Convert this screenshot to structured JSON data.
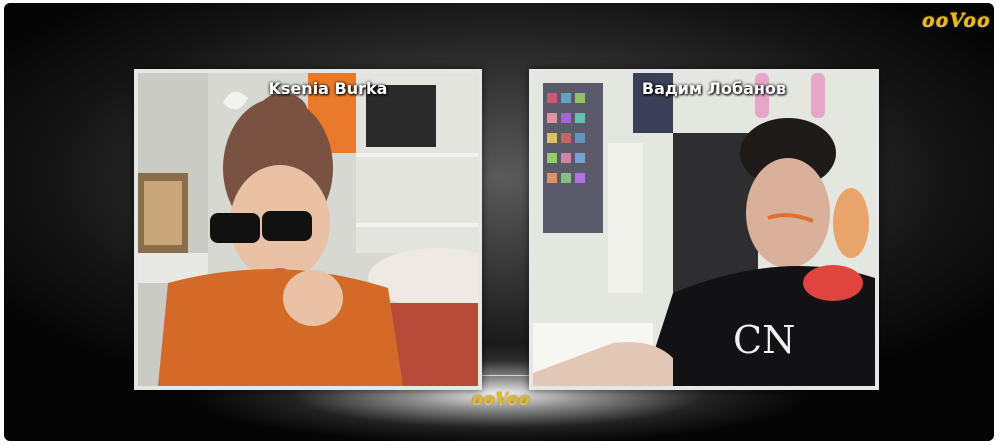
{
  "app": {
    "logo_top": "ooVoo",
    "logo_bottom": "ooVoo"
  },
  "participants": [
    {
      "name": "Ksenia Burka"
    },
    {
      "name": "Вадим Лобанов"
    }
  ],
  "colors": {
    "logo": "#e8b820",
    "tile_border": "#e6e6e6",
    "name_text": "#ffffff"
  }
}
